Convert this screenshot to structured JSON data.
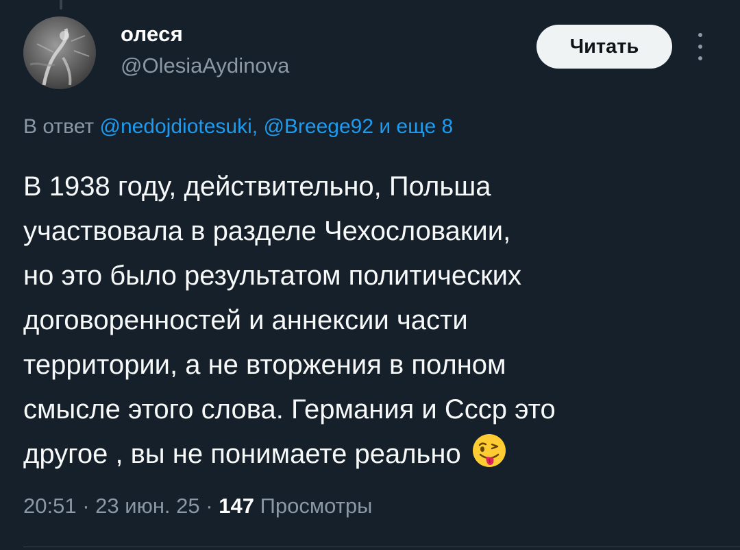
{
  "tweet": {
    "author": {
      "display_name": "олеся",
      "handle": "@OlesiaAydinova"
    },
    "follow_label": "Читать",
    "reply_context": {
      "prefix": "В ответ",
      "mentions": [
        "@nedojdiotesuki",
        "@Breege92"
      ],
      "separator": ",",
      "suffix": "и еще 8"
    },
    "text_lines": [
      "В 1938 году, действительно, Польша",
      "участвовала в разделе Чехословакии,",
      "но это было результатом политических",
      "договоренностей и аннексии части",
      "территории, а не вторжения в полном",
      "смысле этого слова. Германия и Ссср это",
      "другое , вы не понимаете реально"
    ],
    "emoji": "winking-face-with-tongue",
    "time": "20:51",
    "date": "23 июн. 25",
    "separator": "·",
    "views_count": "147",
    "views_label": "Просмотры"
  },
  "icons": {
    "more": "more-vertical-icon",
    "avatar": "profile-photo"
  },
  "colors": {
    "background": "#15202b",
    "primary_text": "#ffffff",
    "secondary_text": "#8b98a5",
    "link": "#1d9bf0",
    "button_bg": "#eff3f4"
  }
}
